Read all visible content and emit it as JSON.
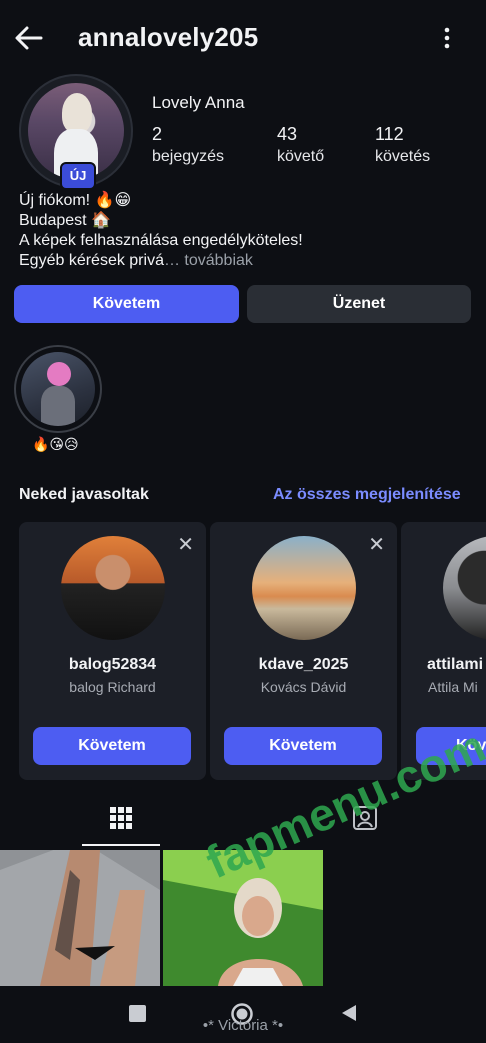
{
  "header": {
    "username": "annalovely205"
  },
  "profile": {
    "display_name": "Lovely Anna",
    "badge": "ÚJ",
    "stats": [
      {
        "value": "2",
        "label": "bejegyzés"
      },
      {
        "value": "43",
        "label": "követő"
      },
      {
        "value": "112",
        "label": "követés"
      }
    ],
    "bio": [
      "Új fiókom! 🔥😁",
      "Budapest 🏠",
      "A képek felhasználása engedélyköteles!",
      "Egyéb kérések privá"
    ],
    "bio_more": "… továbbiak"
  },
  "actions": {
    "follow": "Követem",
    "message": "Üzenet"
  },
  "highlight": {
    "label": "🔥😘😥"
  },
  "suggestions": {
    "title": "Neked javasoltak",
    "see_all": "Az összes megjelenítése",
    "cards": [
      {
        "username": "balog52834",
        "full_name": "balog Richard",
        "button": "Követem"
      },
      {
        "username": "kdave_2025",
        "full_name": "Kovács Dávid",
        "button": "Követem"
      },
      {
        "username": "attilami",
        "full_name": "Attila Mi",
        "button": "Köv"
      }
    ]
  },
  "watermark": "fapmenu.com",
  "nav": {
    "label": "•* Victoria *•"
  },
  "colors": {
    "accent": "#4d5df2",
    "link": "#7b8cff",
    "background": "#0d0f14"
  }
}
